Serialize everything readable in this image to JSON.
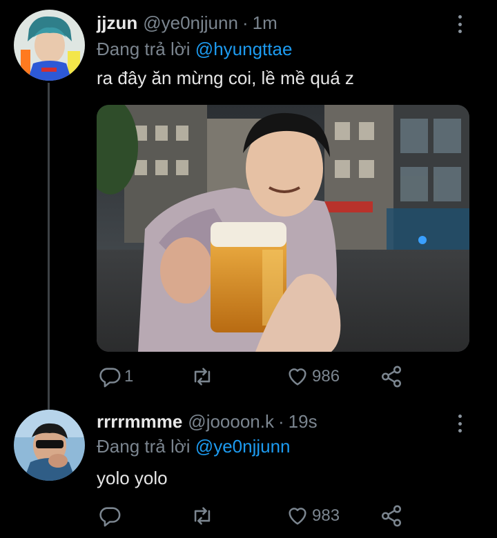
{
  "tweets": [
    {
      "display_name": "jjzun",
      "handle": "@ye0njjunn",
      "separator": "·",
      "time": "1m",
      "reply_prefix": "Đang trả lời",
      "reply_to": "@hyungttae",
      "text": "ra đây ăn mừng coi, lề mề quá z",
      "replies": "1",
      "retweets": "",
      "likes": "986"
    },
    {
      "display_name": "rrrrmmme",
      "handle": "@joooon.k",
      "separator": "·",
      "time": "19s",
      "reply_prefix": "Đang trả lời",
      "reply_to": "@ye0njjunn",
      "text": "yolo yolo",
      "replies": "",
      "retweets": "",
      "likes": "983"
    }
  ],
  "icons": {
    "reply": "reply-icon",
    "retweet": "retweet-icon",
    "like": "heart-icon",
    "share": "share-icon",
    "more": "more-vertical-icon"
  },
  "colors": {
    "background": "#000000",
    "link": "#1d9bf0",
    "muted": "#7b858f",
    "thread_line": "#3d4145"
  }
}
